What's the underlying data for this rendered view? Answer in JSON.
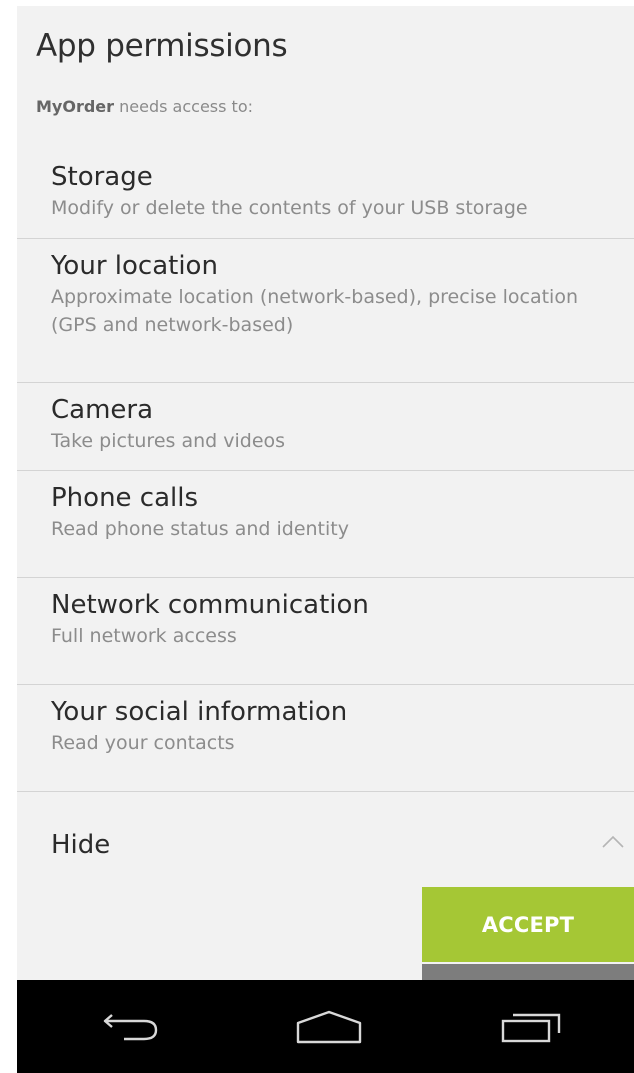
{
  "header": {
    "title": "App permissions",
    "app_name": "MyOrder",
    "subtitle_rest": " needs access to:"
  },
  "permissions": [
    {
      "name": "Storage",
      "description": "Modify or delete the contents of your USB storage"
    },
    {
      "name": "Your location",
      "description": "Approximate location (network-based), precise location (GPS and network-based)"
    },
    {
      "name": "Camera",
      "description": "Take pictures and videos"
    },
    {
      "name": "Phone calls",
      "description": "Read phone status and identity"
    },
    {
      "name": "Network communication",
      "description": "Full network access"
    },
    {
      "name": "Your social information",
      "description": "Read your contacts"
    }
  ],
  "toggle": {
    "label": "Hide",
    "icon": "chevron-up-icon"
  },
  "actions": {
    "accept_label": "ACCEPT"
  },
  "navbar": {
    "back_icon": "back-icon",
    "home_icon": "home-icon",
    "recent_icon": "recent-apps-icon"
  },
  "colors": {
    "accent": "#a5c735",
    "background": "#f2f2f2",
    "navbar": "#000000"
  }
}
